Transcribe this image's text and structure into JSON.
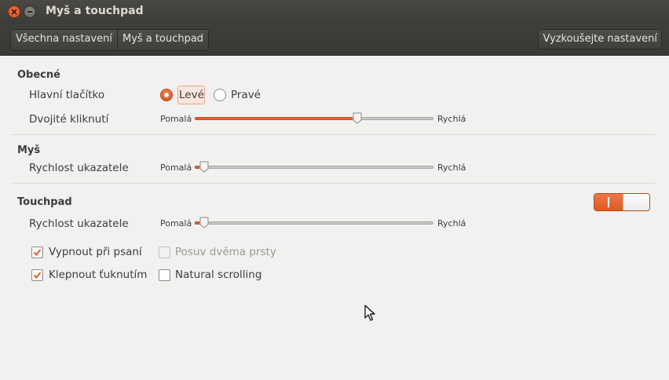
{
  "window": {
    "title": "Myš a touchpad"
  },
  "toolbar": {
    "breadcrumbs": [
      "Všechna nastavení",
      "Myš a touchpad"
    ],
    "test_button": "Vyzkoušejte nastavení"
  },
  "general": {
    "title": "Obecné",
    "primary_button": {
      "label": "Hlavní tlačítko",
      "options": [
        "Levé",
        "Pravé"
      ],
      "selected": "Levé"
    },
    "double_click": {
      "label": "Dvojité kliknutí",
      "min": "Pomalá",
      "max": "Rychlá",
      "value": 0.66
    }
  },
  "mouse": {
    "title": "Myš",
    "pointer_speed": {
      "label": "Rychlost ukazatele",
      "min": "Pomalá",
      "max": "Rychlá",
      "value": 0.02
    }
  },
  "touchpad": {
    "title": "Touchpad",
    "enabled": true,
    "pointer_speed": {
      "label": "Rychlost ukazatele",
      "min": "Pomalá",
      "max": "Rychlá",
      "value": 0.02
    },
    "options": {
      "disable_while_typing": {
        "label": "Vypnout při psaní",
        "checked": true
      },
      "two_finger_scroll": {
        "label": "Posuv dvěma prsty",
        "checked": false,
        "disabled": true
      },
      "tap_to_click": {
        "label": "Klepnout ťuknutím",
        "checked": true
      },
      "natural_scrolling": {
        "label": "Natural scrolling",
        "checked": false
      }
    }
  },
  "colors": {
    "accent": "#e6632e",
    "titlebar": "#3c3b37",
    "background": "#f2f1f0"
  }
}
